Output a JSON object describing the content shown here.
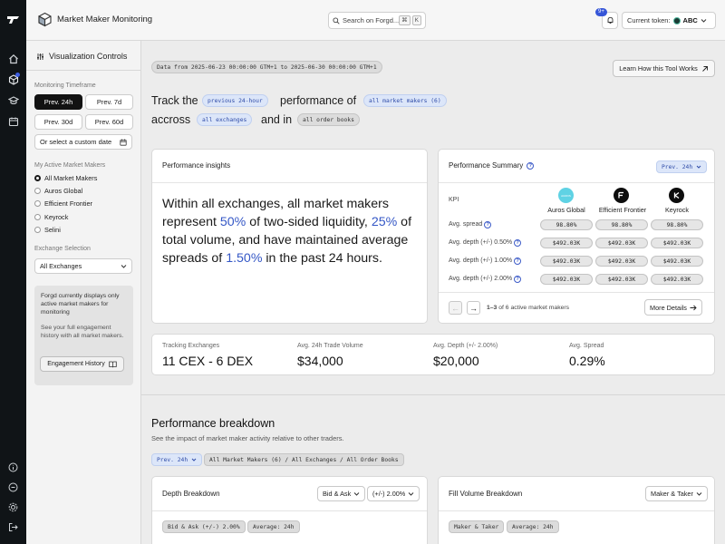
{
  "app": {
    "title": "Market Maker Monitoring"
  },
  "search": {
    "placeholder": "Search on Forgd...",
    "kbd": [
      "⌘",
      "K"
    ]
  },
  "notifications": {
    "badge": "9+"
  },
  "token": {
    "label": "Current token:",
    "value": "ABC"
  },
  "sidebar": {
    "title": "Visualization Controls",
    "timeframe_label": "Monitoring Timeframe",
    "timeframes": [
      "Prev. 24h",
      "Prev. 7d",
      "Prev. 30d",
      "Prev. 60d"
    ],
    "custom_date": "Or select a custom date",
    "mm_label": "My Active Market Makers",
    "market_makers": [
      "All Market Makers",
      "Auros Global",
      "Efficient Frontier",
      "Keyrock",
      "Selini"
    ],
    "exchange_label": "Exchange Selection",
    "exchange_value": "All Exchanges",
    "info_title": "Forgd currently displays only active market makers for monitoring",
    "info_body": "See your full engagement history with all market makers.",
    "engagement_button": "Engagement History"
  },
  "header": {
    "date_range": "Data from 2025-06-23 00:00:00 GTM+1 to 2025-06-30 00:00:00 GTM+1",
    "learn_button": "Learn How this Tool Works",
    "sentence": {
      "w1": "Track the",
      "p1": "previous 24-hour",
      "w2": "performance of",
      "p2": "all market makers (6)",
      "w3": "accross",
      "p3": "all exchanges",
      "w4": "and in",
      "p4": "all order books"
    }
  },
  "insights": {
    "title": "Performance insights",
    "t1": "Within all exchanges, all market makers represent ",
    "v1": "50%",
    "t2": " of two-sided liquidity, ",
    "v2": "25%",
    "t3": " of total volume, and have maintained average spreads of ",
    "v3": "1.50%",
    "t4": " in the past 24 hours."
  },
  "summary": {
    "title": "Performance Summary",
    "period_pill": "Prev. 24h",
    "kpi_label": "KPI",
    "makers": [
      "Auros Global",
      "Efficient Frontier",
      "Keyrock"
    ],
    "rows": [
      {
        "label": "Avg. spread",
        "values": [
          "98.80%",
          "98.80%",
          "98.80%"
        ]
      },
      {
        "label": "Avg. depth (+/-) 0.50%",
        "values": [
          "$492.03K",
          "$492.03K",
          "$492.03K"
        ]
      },
      {
        "label": "Avg. depth (+/-) 1.00%",
        "values": [
          "$492.03K",
          "$492.03K",
          "$492.03K"
        ]
      },
      {
        "label": "Avg. depth (+/-) 2.00%",
        "values": [
          "$492.03K",
          "$492.03K",
          "$492.03K"
        ]
      }
    ],
    "pager_text": "1–3 of 6 active market makers",
    "pager_range": "1–3",
    "pager_rest": " of 6 active market makers",
    "more_button": "More Details"
  },
  "stats": [
    {
      "label": "Tracking Exchanges",
      "value": "11 CEX - 6 DEX"
    },
    {
      "label": "Avg. 24h Trade Volume",
      "value": "$34,000"
    },
    {
      "label": "Avg. Depth (+/- 2.00%)",
      "value": "$20,000"
    },
    {
      "label": "Avg. Spread",
      "value": "0.29%"
    }
  ],
  "breakdown": {
    "title": "Performance breakdown",
    "subtitle": "See the impact of market maker activity relative to other traders.",
    "period_pill": "Prev. 24h",
    "scope_pill": "All Market Makers (6) / All Exchanges / All Order Books",
    "depth": {
      "title": "Depth Breakdown",
      "dd1": "Bid & Ask",
      "dd2": "(+/-) 2.00%",
      "pill1": "Bid & Ask (+/-) 2.00%",
      "pill2": "Average: 24h"
    },
    "fill": {
      "title": "Fill Volume Breakdown",
      "dd1": "Maker & Taker",
      "pill1": "Maker & Taker",
      "pill2": "Average: 24h"
    }
  },
  "colors": {
    "accent": "#3457c6",
    "dark": "#121212",
    "rail": "#101417"
  }
}
